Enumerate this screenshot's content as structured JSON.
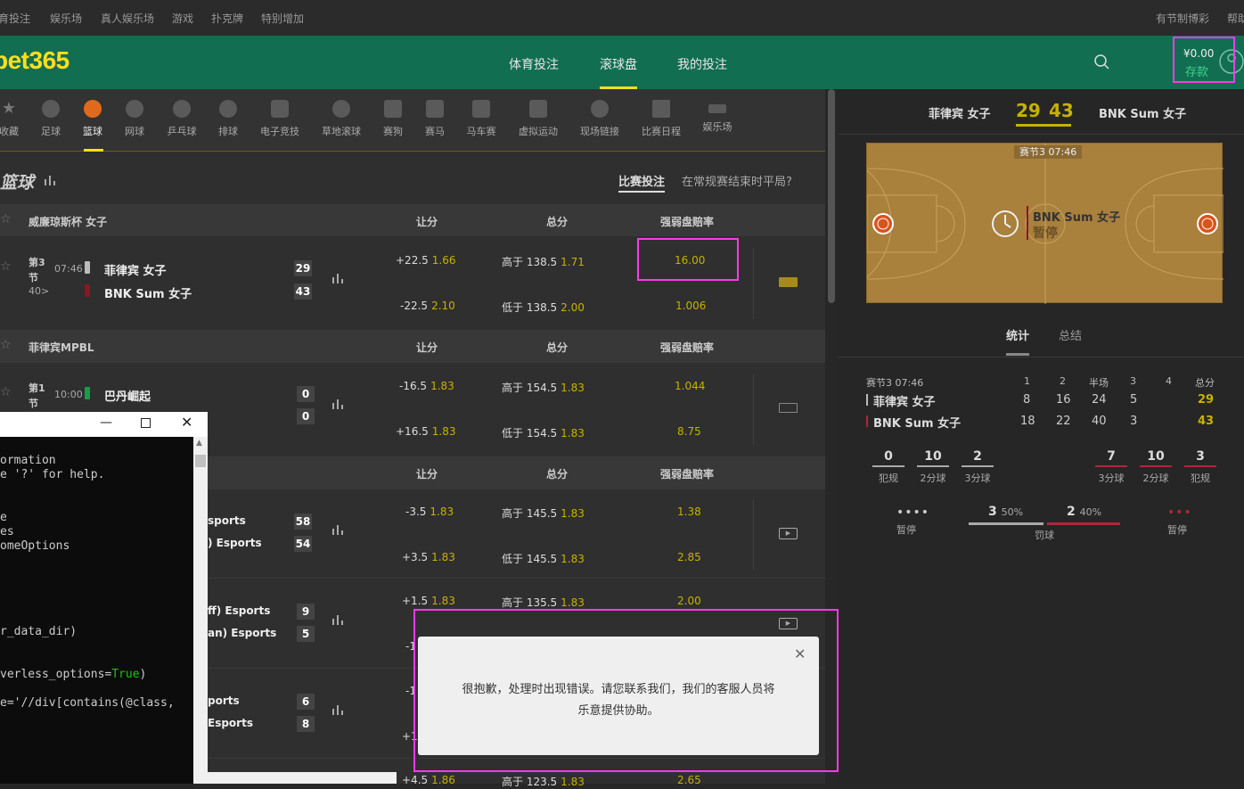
{
  "topbar": {
    "links": [
      "育投注",
      "娱乐场",
      "真人娱乐场",
      "游戏",
      "扑克牌",
      "特别增加"
    ],
    "right1": "有节制博彩",
    "right2": "帮助"
  },
  "header": {
    "logo": "bet365",
    "tabs": [
      "体育投注",
      "滚球盘",
      "我的投注"
    ],
    "balance": "¥0.00",
    "deposit": "存款"
  },
  "sports": [
    "收藏",
    "足球",
    "篮球",
    "网球",
    "乒乓球",
    "排球",
    "电子竞技",
    "草地滚球",
    "赛狗",
    "赛马",
    "马车赛",
    "虚拟运动",
    "现场链接",
    "比赛日程",
    "娱乐场"
  ],
  "section": {
    "title": "篮球",
    "tab_active": "比赛投注",
    "tab_other": "在常规赛结束时平局?"
  },
  "columns": {
    "spread": "让分",
    "total": "总分",
    "moneyline": "强弱盘赔率"
  },
  "leagues": [
    {
      "name": "威廉琼斯杯 女子"
    },
    {
      "name": "菲律宾MPBL"
    }
  ],
  "match1": {
    "period": "第3",
    "period2": "节",
    "time": "07:46",
    "count": "40>",
    "team1": "菲律宾 女子",
    "team2": "BNK Sum 女子",
    "score1": "29",
    "score2": "43",
    "spread1": "+22.5",
    "spread1_odds": "1.66",
    "spread2": "-22.5",
    "spread2_odds": "2.10",
    "total1": "高于 138.5",
    "total1_odds": "1.71",
    "total2": "低于 138.5",
    "total2_odds": "2.00",
    "ml1": "16.00",
    "ml2": "1.006"
  },
  "match2": {
    "period": "第1",
    "period2": "节",
    "time": "10:00",
    "team1": "巴丹崛起",
    "score1": "0",
    "score2": "0",
    "spread1": "-16.5",
    "spread1_odds": "1.83",
    "spread2": "+16.5",
    "spread2_odds": "1.83",
    "total1": "高于 154.5",
    "total1_odds": "1.83",
    "total2": "低于 154.5",
    "total2_odds": "1.83",
    "ml1": "1.044",
    "ml2": "8.75"
  },
  "match3": {
    "team1": "sports",
    "team2": ") Esports",
    "score1": "58",
    "score2": "54",
    "spread1": "-3.5",
    "spread1_odds": "1.83",
    "spread2": "+3.5",
    "spread2_odds": "1.83",
    "total1": "高于 145.5",
    "total1_odds": "1.83",
    "total2": "低于 145.5",
    "total2_odds": "1.83",
    "ml1": "1.38",
    "ml2": "2.85"
  },
  "match4": {
    "team1": "ff) Esports",
    "team2": "an) Esports",
    "score1": "9",
    "score2": "5",
    "spread1": "+1.5",
    "spread1_odds": "1.83",
    "total1": "高于 135.5",
    "total1_odds": "1.83",
    "ml1": "2.00"
  },
  "match5": {
    "team1": "ports",
    "team2": "Esports",
    "score1": "6",
    "score2": "8",
    "spread1": "+4.5",
    "spread1_odds": "1.86",
    "total1": "高于 123.5",
    "total1_odds": "1.83",
    "ml1": "2.65",
    "partial_a": "-1",
    "partial_b": "-1",
    "partial_c": "+1"
  },
  "terminal": {
    "lines": [
      "ormation",
      "e '?' for help.",
      "e",
      "es",
      "omeOptions",
      "r_data_dir)",
      "verless_options=",
      "e='//div[contains(@class,"
    ],
    "true_word": "True"
  },
  "modal": {
    "line1": "很抱歉，处理时出现错误。请您联系我们，我们的客服人员将",
    "line2": "乐意提供协助。"
  },
  "right": {
    "team1": "菲律宾 女子",
    "team2": "BNK Sum 女子",
    "score1": "29",
    "score2": "43",
    "court_badge": "赛节3  07:46",
    "court_team": "BNK Sum 女子",
    "court_status": "暂停",
    "tab_stats": "统计",
    "tab_summary": "总结",
    "period_label": "赛节3 07:46",
    "col_headers": [
      "1",
      "2",
      "半场",
      "3",
      "4",
      "总分"
    ],
    "row1": {
      "name": "菲律宾 女子",
      "vals": [
        "8",
        "16",
        "24",
        "5",
        "",
        "29"
      ]
    },
    "row2": {
      "name": "BNK Sum 女子",
      "vals": [
        "18",
        "22",
        "40",
        "3",
        "",
        "43"
      ]
    },
    "left_stats": [
      {
        "v": "0",
        "l": "犯规"
      },
      {
        "v": "10",
        "l": "2分球"
      },
      {
        "v": "2",
        "l": "3分球"
      }
    ],
    "right_stats": [
      {
        "v": "7",
        "l": "3分球"
      },
      {
        "v": "10",
        "l": "2分球"
      },
      {
        "v": "3",
        "l": "犯规"
      }
    ],
    "timeout_label": "暂停",
    "ft_left": "3",
    "ft_left_pct": "50%",
    "ft_right": "2",
    "ft_right_pct": "40%",
    "ft_label": "罚球"
  },
  "colors": {
    "header_green": "#126e51",
    "gold": "#ffdf1b",
    "odds": "#c7b100",
    "highlight": "#ff39e9"
  }
}
